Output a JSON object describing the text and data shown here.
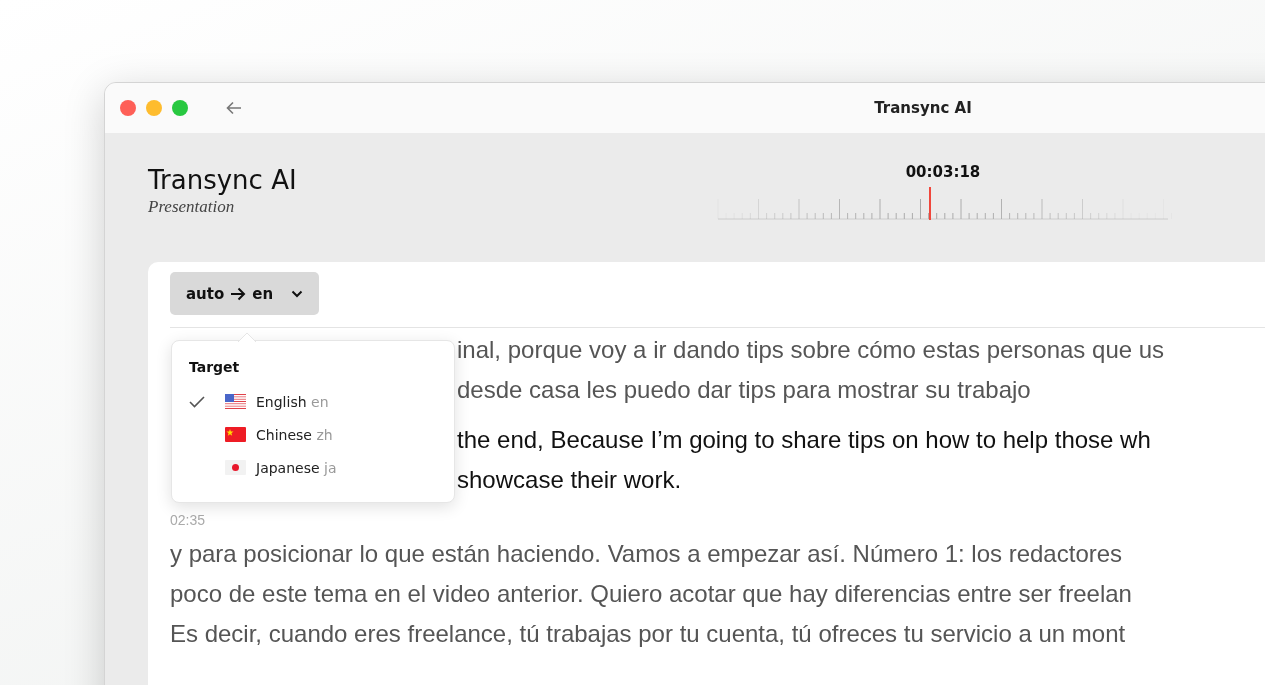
{
  "window": {
    "title": "Transync AI"
  },
  "header": {
    "app_name": "Transync AI",
    "subtitle": "Presentation",
    "time": "00:03:18"
  },
  "language_button": {
    "source": "auto",
    "target": "en"
  },
  "dropdown": {
    "heading": "Target",
    "options": [
      {
        "name": "English",
        "code": "en",
        "kind": "us",
        "selected": true
      },
      {
        "name": "Chinese",
        "code": "zh",
        "kind": "cn",
        "selected": false
      },
      {
        "name": "Japanese",
        "code": "ja",
        "kind": "jp",
        "selected": false
      }
    ]
  },
  "transcript": {
    "segments": [
      {
        "partially_hidden": true,
        "original_lines": [
          "inal, porque voy a ir dando tips sobre cómo estas personas que us",
          "desde casa les puedo dar tips para mostrar su trabajo"
        ],
        "translation_lines": [
          "the end, Because I’m going to share tips on how to help those wh",
          "showcase their work."
        ]
      },
      {
        "partially_hidden": false,
        "timestamp": "02:35",
        "original_lines": [
          "y para posicionar lo que están haciendo. Vamos a empezar así. Número 1: los redactores",
          "poco de este tema en el video anterior. Quiero acotar que hay diferencias entre ser freelan",
          "Es decir, cuando eres freelance, tú trabajas por tu cuenta, tú ofreces tu servicio a un mont"
        ]
      }
    ]
  }
}
